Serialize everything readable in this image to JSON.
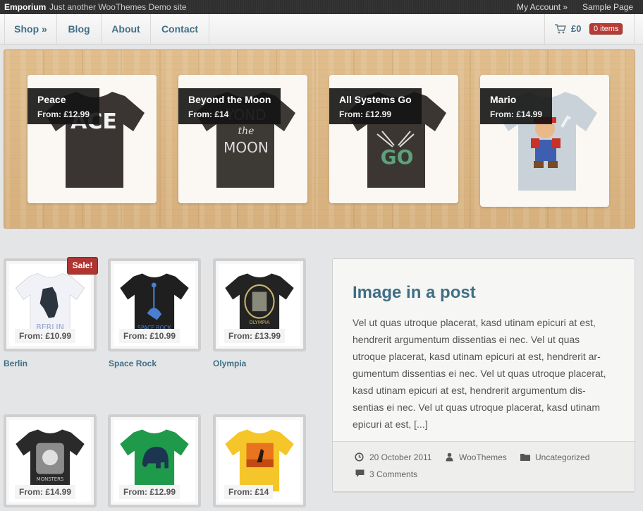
{
  "topbar": {
    "site_name": "Emporium",
    "site_description": "Just another WooThemes Demo site",
    "links": [
      "My Account »",
      "Sample Page"
    ]
  },
  "nav": {
    "items": [
      "Shop »",
      "Blog",
      "About",
      "Contact"
    ],
    "cart_total": "£0",
    "cart_items": "0 items"
  },
  "featured": [
    {
      "title": "Peace",
      "price": "From: £12.99",
      "shirt_color": "#3a3532",
      "print_text": "ACE"
    },
    {
      "title": "Beyond the Moon",
      "price": "From: £14",
      "shirt_color": "#3d3935",
      "print_text": "MOON"
    },
    {
      "title": "All Systems Go",
      "price": "From: £12.99",
      "shirt_color": "#3b3632",
      "print_text": "GO"
    },
    {
      "title": "Mario",
      "price": "From: £14.99",
      "shirt_color": "#c9d2d8",
      "print_text": ""
    }
  ],
  "products": [
    {
      "name": "Berlin",
      "price": "From: £10.99",
      "shirt_color": "#f1f2f8",
      "sale": true
    },
    {
      "name": "Space Rock",
      "price": "From: £10.99",
      "shirt_color": "#1f1f1f",
      "sale": false
    },
    {
      "name": "Olympia",
      "price": "From: £13.99",
      "shirt_color": "#232323",
      "sale": false
    },
    {
      "name": "",
      "price": "From: £14.99",
      "shirt_color": "#2a2a2a",
      "sale": false
    },
    {
      "name": "",
      "price": "From: £12.99",
      "shirt_color": "#1e9a4a",
      "sale": false
    },
    {
      "name": "",
      "price": "From: £14",
      "shirt_color": "#f5c62a",
      "sale": false
    }
  ],
  "sale_label": "Sale!",
  "post": {
    "title": "Image in a post",
    "lines": [
      "Vel ut quas utroque placerat, kasd utinam epicuri at est,",
      "hendrerit argumentum dissentias ei nec. Vel ut quas",
      "utroque placerat, kasd utinam epicuri at est, hendrerit ar-",
      "gumentum dissentias ei nec. Vel ut quas utroque placerat,",
      "kasd utinam epicuri at est, hendrerit argumentum dis-",
      "sentias ei nec. Vel ut quas utroque placerat, kasd utinam",
      "epicuri at est, [...]"
    ],
    "date": "20 October 2011",
    "author": "WooThemes",
    "category": "Uncategorized",
    "comments": "3 Comments"
  },
  "icons": {
    "cart": "cart-icon",
    "date": "clock-icon",
    "author": "user-icon",
    "category": "folder-icon",
    "comments": "comment-icon"
  },
  "colors": {
    "link": "#3f6f86",
    "sale": "#b03530",
    "badge": "#b83a35"
  }
}
